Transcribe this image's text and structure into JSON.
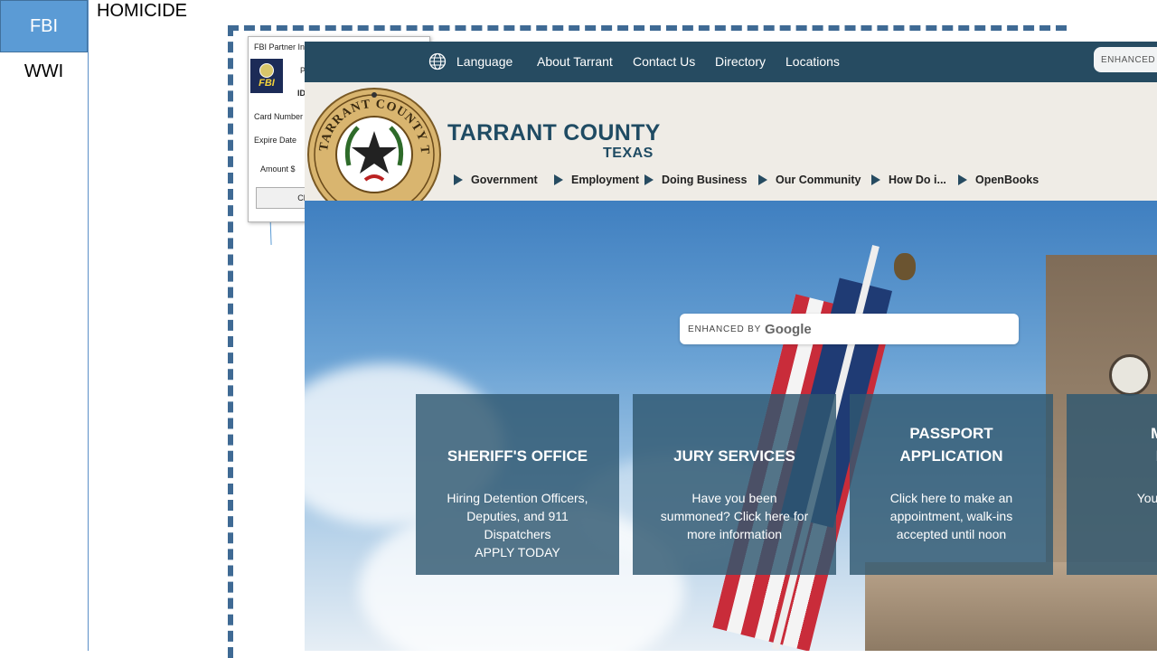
{
  "slide": {
    "tab_fbi": "FBI",
    "tab_wwi": "WWI",
    "heading": "HOMICIDE"
  },
  "fbi_window": {
    "title": "FBI Partner In",
    "logo_text": "FBI",
    "field_p": "P",
    "field_id": "ID",
    "card_number_label": "Card Number",
    "expire_date_label": "Expire Date",
    "amount_label": "Amount $",
    "button_label": "Ch"
  },
  "site": {
    "topnav": {
      "language": "Language",
      "about": "About Tarrant",
      "contact": "Contact Us",
      "directory": "Directory",
      "locations": "Locations",
      "enhanced": "ENHANCED B"
    },
    "brand": {
      "line1": "TARRANT COUNTY",
      "line2": "TEXAS",
      "seal_text": "TARRANT COUNTY TEXAS"
    },
    "mainnav": [
      "Government",
      "Employment",
      "Doing Business",
      "Our Community",
      "How Do i...",
      "OpenBooks"
    ],
    "search": {
      "prefix": "ENHANCED BY",
      "brand": "Google"
    },
    "cards": [
      {
        "title_1": "SHERIFF'S OFFICE",
        "title_2": "",
        "desc": [
          "Hiring Detention Officers,",
          "Deputies, and 911",
          "Dispatchers",
          "APPLY TODAY"
        ]
      },
      {
        "title_1": "JURY SERVICES",
        "title_2": "",
        "desc": [
          "Have you been",
          "summoned? Click here for",
          "more information"
        ]
      },
      {
        "title_1": "PASSPORT",
        "title_2": "APPLICATION",
        "desc": [
          "Click here to make an",
          "appointment, walk-ins",
          "accepted until noon"
        ]
      },
      {
        "title_1": "MAR",
        "title_2": "LIC",
        "desc": [
          "You can no"
        ]
      }
    ]
  }
}
